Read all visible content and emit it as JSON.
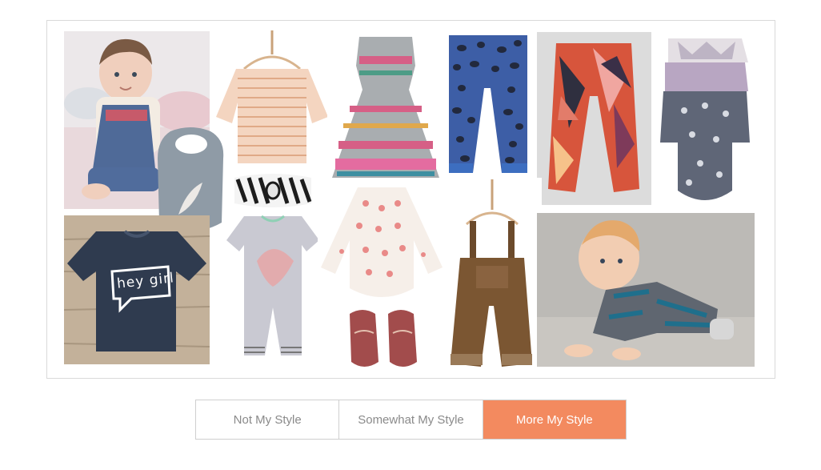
{
  "collage": {
    "items": [
      {
        "icon": "baby-girl-photo"
      },
      {
        "icon": "striped-sweater"
      },
      {
        "icon": "patterned-dress"
      },
      {
        "icon": "spotted-leggings"
      },
      {
        "icon": "feather-print-pants"
      },
      {
        "icon": "bodysuit-stack"
      },
      {
        "icon": "feather-bib"
      },
      {
        "icon": "striped-headband"
      },
      {
        "icon": "graphic-tee"
      },
      {
        "icon": "headdress-romper"
      },
      {
        "icon": "floral-bodysuit"
      },
      {
        "icon": "baby-shoes"
      },
      {
        "icon": "corduroy-overalls"
      },
      {
        "icon": "crawling-baby-photo"
      }
    ],
    "tee_text": "hey girl"
  },
  "style_options": [
    {
      "label": "Not My Style",
      "selected": false
    },
    {
      "label": "Somewhat My Style",
      "selected": false
    },
    {
      "label": "More My Style",
      "selected": true
    }
  ],
  "colors": {
    "accent": "#f38a5f",
    "frame_border": "#d9d9d9",
    "button_text": "#8a8a8a"
  }
}
